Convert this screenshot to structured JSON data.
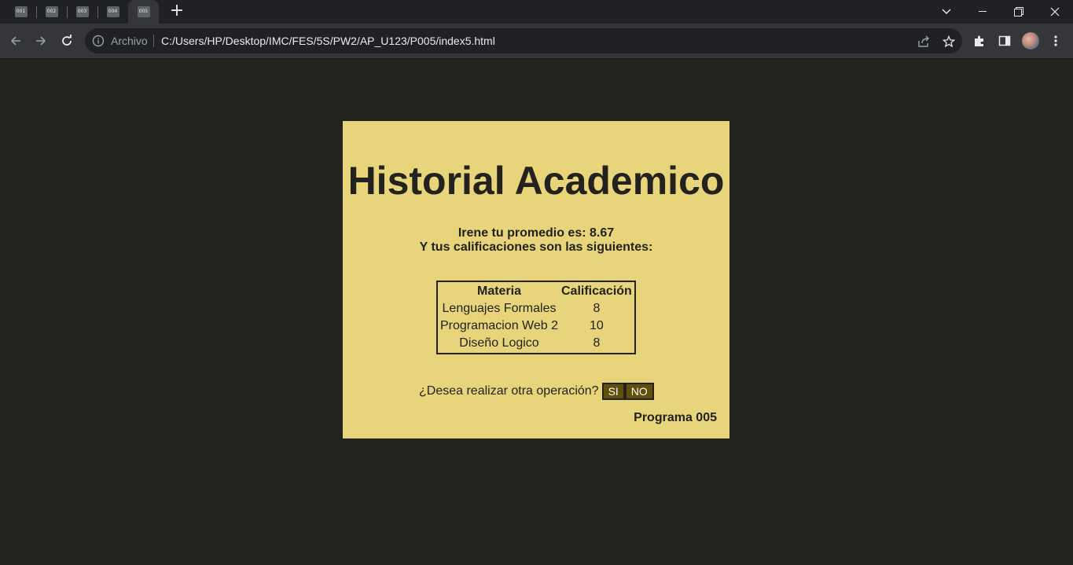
{
  "browser": {
    "tabs": [
      {
        "label": "001",
        "active": false
      },
      {
        "label": "002",
        "active": false
      },
      {
        "label": "003",
        "active": false
      },
      {
        "label": "004",
        "active": false
      },
      {
        "label": "005",
        "active": true
      }
    ],
    "new_tab_label": "+",
    "address": {
      "security_label": "Archivo",
      "url": "C:/Users/HP/Desktop/IMC/FES/5S/PW2/AP_U123/P005/index5.html"
    }
  },
  "page": {
    "title": "Historial Academico",
    "message_line1": "Irene tu promedio es: 8.67",
    "message_line2": "Y tus calificaciones son las siguientes:",
    "table": {
      "headers": [
        "Materia",
        "Calificación"
      ],
      "rows": [
        [
          "Lenguajes Formales",
          "8"
        ],
        [
          "Programacion Web 2",
          "10"
        ],
        [
          "Diseño Logico",
          "8"
        ]
      ]
    },
    "question": "¿Desea realizar otra operación?",
    "yes_label": "SI",
    "no_label": "NO",
    "footer": "Programa 005"
  },
  "colors": {
    "page_background": "#23221e",
    "card_background": "#e8d47a",
    "button_background": "#5f4f08"
  }
}
